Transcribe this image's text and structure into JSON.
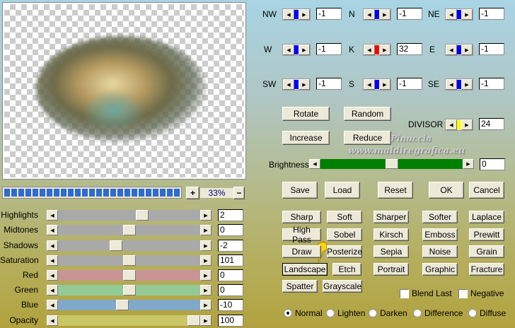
{
  "preview": {
    "zoom": "33%",
    "zoom_in": "+",
    "zoom_out": "−",
    "progress_percent": 100
  },
  "adjust": [
    {
      "label": "Highlights",
      "value": "2",
      "pos": 0.6,
      "color": "#a9a9a9"
    },
    {
      "label": "Midtones",
      "value": "0",
      "pos": 0.5,
      "color": "#a9a9a9"
    },
    {
      "label": "Shadows",
      "value": "-2",
      "pos": 0.4,
      "color": "#a9a9a9"
    },
    {
      "label": "Saturation",
      "value": "101",
      "pos": 0.5,
      "color": "#a9a9a9"
    },
    {
      "label": "Red",
      "value": "0",
      "pos": 0.5,
      "color": "#c89496"
    },
    {
      "label": "Green",
      "value": "0",
      "pos": 0.5,
      "color": "#93c994"
    },
    {
      "label": "Blue",
      "value": "-10",
      "pos": 0.45,
      "color": "#7fa8c9"
    },
    {
      "label": "Opacity",
      "value": "100",
      "pos": 1.0,
      "color": "#c9c765"
    }
  ],
  "kernel": [
    {
      "label": "NW",
      "value": "-1",
      "color": "#0000ff"
    },
    {
      "label": "N",
      "value": "-1",
      "color": "#0000ff"
    },
    {
      "label": "NE",
      "value": "-1",
      "color": "#0000ff"
    },
    {
      "label": "W",
      "value": "-1",
      "color": "#0000ff"
    },
    {
      "label": "K",
      "value": "32",
      "color": "#ff0000"
    },
    {
      "label": "E",
      "value": "-1",
      "color": "#0000ff"
    },
    {
      "label": "SW",
      "value": "-1",
      "color": "#0000ff"
    },
    {
      "label": "S",
      "value": "-1",
      "color": "#0000ff"
    },
    {
      "label": "SE",
      "value": "-1",
      "color": "#0000ff"
    }
  ],
  "buttons": {
    "rotate": "Rotate",
    "random": "Random",
    "increase": "Increase",
    "reduce": "Reduce",
    "save": "Save",
    "load": "Load",
    "reset": "Reset",
    "ok": "OK",
    "cancel": "Cancel"
  },
  "divisor": {
    "label": "DIVISOR",
    "value": "24",
    "color": "#ffff00"
  },
  "brightness": {
    "label": "Brightness",
    "value": "0",
    "pos": 0.5,
    "color": "#008000"
  },
  "watermark": {
    "line1": "Pinuccia",
    "line2": "www.maldiregrafica.eu"
  },
  "presets": [
    [
      "Sharp",
      "Soft",
      "Sharper",
      "Softer",
      "Laplace"
    ],
    [
      "High Pass",
      "Sobel",
      "Kirsch",
      "Emboss",
      "Prewitt"
    ],
    [
      "Draw",
      "Posterize",
      "Sepia",
      "Noise",
      "Grain"
    ],
    [
      "Landscape",
      "Etch",
      "Portrait",
      "Graphic",
      "Fracture"
    ],
    [
      "Spatter",
      "Grayscale"
    ]
  ],
  "focused_preset": "Landscape",
  "checkboxes": [
    {
      "label": "Blend Last",
      "checked": false
    },
    {
      "label": "Negative",
      "checked": false
    }
  ],
  "modes": [
    {
      "label": "Normal",
      "selected": true
    },
    {
      "label": "Lighten",
      "selected": false
    },
    {
      "label": "Darken",
      "selected": false
    },
    {
      "label": "Difference",
      "selected": false
    },
    {
      "label": "Diffuse",
      "selected": false
    }
  ]
}
